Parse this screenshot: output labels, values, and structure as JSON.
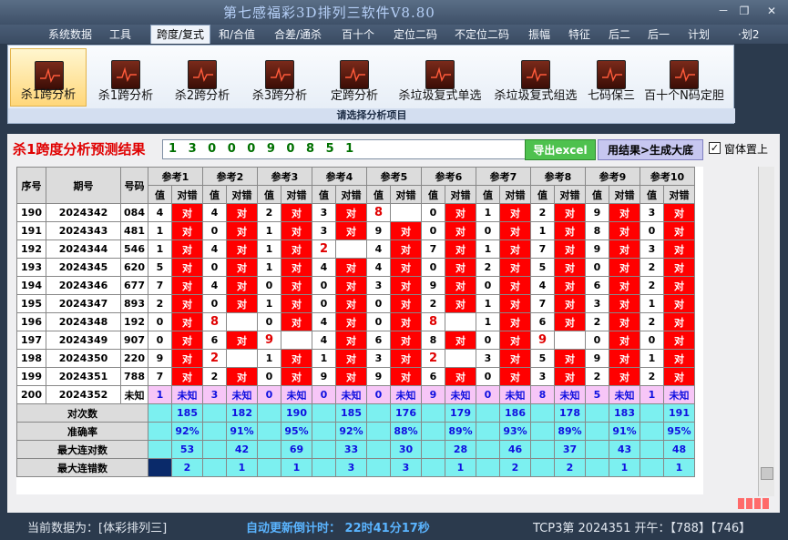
{
  "app_title": "第七感福彩3D排列三软件V8.80",
  "window_buttons": [
    "－",
    "❐",
    "✕"
  ],
  "menu": [
    "系统数据",
    "工具",
    "跨度/复式",
    "和/合值",
    "合差/通杀",
    "百十个",
    "定位二码",
    "不定位二码",
    "振幅",
    "特征",
    "后二",
    "后一",
    "计划",
    "·划2"
  ],
  "menu_active_index": 2,
  "ribbon_buttons": [
    "杀1跨分析",
    "杀1跨分析",
    "杀2跨分析",
    "杀3跨分析",
    "定跨分析",
    "杀垃圾复式单选",
    "杀垃圾复式组选",
    "七码保三",
    "百十个N码定胆"
  ],
  "ribbon_active_index": 0,
  "ribbon_group_label": "请选择分析项目",
  "result_title": "杀1跨度分析预测结果",
  "result_value": "1 3 0 0 0 9 0 8 5 1",
  "export_button": "导出excel",
  "generate_button": "用结果>生成大底",
  "topmost_label": "窗体置上",
  "topmost_checked": "✓",
  "headers": {
    "seq": "序号",
    "period": "期号",
    "number": "号码",
    "val": "值",
    "mark": "对错"
  },
  "ref_headers": [
    "参考1",
    "参考2",
    "参考3",
    "参考4",
    "参考5",
    "参考6",
    "参考7",
    "参考8",
    "参考9",
    "参考10"
  ],
  "rows": [
    {
      "seq": "190",
      "period": "2024342",
      "num": "084",
      "v": [
        "4",
        "4",
        "2",
        "3",
        "8",
        "0",
        "1",
        "2",
        "9",
        "3"
      ],
      "m": [
        "对",
        "对",
        "对",
        "对",
        "",
        "对",
        "对",
        "对",
        "对",
        "对"
      ]
    },
    {
      "seq": "191",
      "period": "2024343",
      "num": "481",
      "v": [
        "1",
        "0",
        "1",
        "3",
        "9",
        "0",
        "0",
        "1",
        "8",
        "0"
      ],
      "m": [
        "对",
        "对",
        "对",
        "对",
        "对",
        "对",
        "对",
        "对",
        "对",
        "对"
      ]
    },
    {
      "seq": "192",
      "period": "2024344",
      "num": "546",
      "v": [
        "1",
        "4",
        "1",
        "2",
        "4",
        "7",
        "1",
        "7",
        "9",
        "3"
      ],
      "m": [
        "对",
        "对",
        "对",
        "",
        "对",
        "对",
        "对",
        "对",
        "对",
        "对"
      ]
    },
    {
      "seq": "193",
      "period": "2024345",
      "num": "620",
      "v": [
        "5",
        "0",
        "1",
        "4",
        "4",
        "0",
        "2",
        "5",
        "0",
        "2"
      ],
      "m": [
        "对",
        "对",
        "对",
        "对",
        "对",
        "对",
        "对",
        "对",
        "对",
        "对"
      ]
    },
    {
      "seq": "194",
      "period": "2024346",
      "num": "677",
      "v": [
        "7",
        "4",
        "0",
        "0",
        "3",
        "9",
        "0",
        "4",
        "6",
        "2"
      ],
      "m": [
        "对",
        "对",
        "对",
        "对",
        "对",
        "对",
        "对",
        "对",
        "对",
        "对"
      ]
    },
    {
      "seq": "195",
      "period": "2024347",
      "num": "893",
      "v": [
        "2",
        "0",
        "1",
        "0",
        "0",
        "2",
        "1",
        "7",
        "3",
        "1"
      ],
      "m": [
        "对",
        "对",
        "对",
        "对",
        "对",
        "对",
        "对",
        "对",
        "对",
        "对"
      ]
    },
    {
      "seq": "196",
      "period": "2024348",
      "num": "192",
      "v": [
        "0",
        "8",
        "0",
        "4",
        "0",
        "8",
        "1",
        "6",
        "2",
        "2"
      ],
      "m": [
        "对",
        "",
        "对",
        "对",
        "对",
        "",
        "对",
        "对",
        "对",
        "对"
      ]
    },
    {
      "seq": "197",
      "period": "2024349",
      "num": "907",
      "v": [
        "0",
        "6",
        "9",
        "4",
        "6",
        "8",
        "0",
        "9",
        "0",
        "0"
      ],
      "m": [
        "对",
        "对",
        "",
        "对",
        "对",
        "对",
        "对",
        "",
        "对",
        "对"
      ]
    },
    {
      "seq": "198",
      "period": "2024350",
      "num": "220",
      "v": [
        "9",
        "2",
        "1",
        "1",
        "3",
        "2",
        "3",
        "5",
        "9",
        "1"
      ],
      "m": [
        "对",
        "",
        "对",
        "对",
        "对",
        "",
        "对",
        "对",
        "对",
        "对"
      ]
    },
    {
      "seq": "199",
      "period": "2024351",
      "num": "788",
      "v": [
        "7",
        "2",
        "0",
        "9",
        "9",
        "6",
        "0",
        "3",
        "2",
        "2"
      ],
      "m": [
        "对",
        "对",
        "对",
        "对",
        "对",
        "对",
        "对",
        "对",
        "对",
        "对"
      ]
    }
  ],
  "predict_row": {
    "seq": "200",
    "period": "2024352",
    "num": "未知",
    "v": [
      "1",
      "3",
      "0",
      "0",
      "0",
      "9",
      "0",
      "8",
      "5",
      "1"
    ],
    "m": [
      "未知",
      "未知",
      "未知",
      "未知",
      "未知",
      "未知",
      "未知",
      "未知",
      "未知",
      "未知"
    ]
  },
  "stats": [
    {
      "label": "对次数",
      "values": [
        "185",
        "182",
        "190",
        "185",
        "176",
        "179",
        "186",
        "178",
        "183",
        "191"
      ]
    },
    {
      "label": "准确率",
      "values": [
        "92%",
        "91%",
        "95%",
        "92%",
        "88%",
        "89%",
        "93%",
        "89%",
        "91%",
        "95%"
      ]
    },
    {
      "label": "最大连对数",
      "values": [
        "53",
        "42",
        "69",
        "33",
        "30",
        "28",
        "46",
        "37",
        "43",
        "48"
      ]
    },
    {
      "label": "最大连错数",
      "values": [
        "2",
        "1",
        "1",
        "3",
        "3",
        "1",
        "2",
        "2",
        "1",
        "1"
      ]
    }
  ],
  "status": {
    "left": "当前数据为：[体彩排列三]",
    "countdown": "自动更新倒计时： 22时41分17秒",
    "right": "TCP3第 2024351 开午：【788】【746】"
  },
  "colors": {
    "hit": "#ff0000",
    "predict": "#f7c6f7",
    "stats": "#7cf0f0",
    "title_red": "#e00000",
    "export_green": "#4ec14e"
  }
}
